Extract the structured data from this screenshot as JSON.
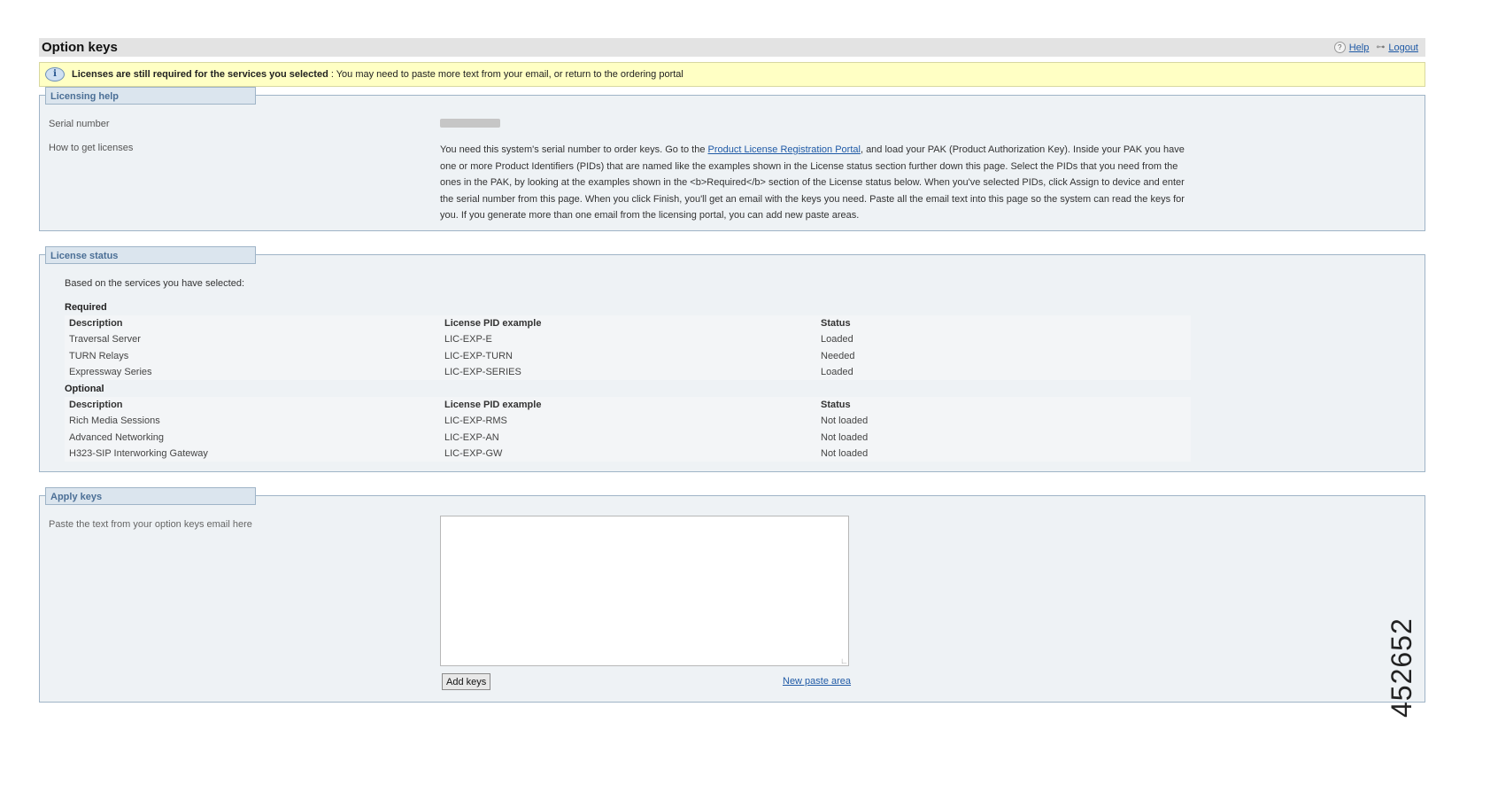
{
  "header": {
    "title": "Option keys",
    "help_label": "Help",
    "logout_label": "Logout"
  },
  "alert": {
    "bold": "Licenses are still required for the services you selected",
    "text": ": You may need to paste more text from your email, or return to the ordering portal"
  },
  "licensing_help": {
    "legend": "Licensing help",
    "serial_label": "Serial number",
    "how_label": "How to get licenses",
    "help_part1": "You need this system's serial number to order keys. Go to the ",
    "portal_link": "Product License Registration Portal",
    "help_part2": ", and load your PAK (Product Authorization Key). Inside your PAK you have one or more Product Identifiers (PIDs) that are named like the examples shown in the License status section further down this page. Select the PIDs that you need from the ones in the PAK, by looking at the examples shown in the <b>Required</b> section of the License status below. When you've selected PIDs, click Assign to device and enter the serial number from this page. When you click Finish, you'll get an email with the keys you need. Paste all the email text into this page so the system can read the keys for you. If you generate more than one email from the licensing portal, you can add new paste areas."
  },
  "license_status": {
    "legend": "License status",
    "based_on": "Based on the services you have selected:",
    "required": {
      "label": "Required",
      "headers": [
        "Description",
        "License PID example",
        "Status"
      ],
      "rows": [
        {
          "description": "Traversal Server",
          "pid": "LIC-EXP-E",
          "status": "Loaded"
        },
        {
          "description": "TURN Relays",
          "pid": "LIC-EXP-TURN",
          "status": "Needed"
        },
        {
          "description": "Expressway Series",
          "pid": "LIC-EXP-SERIES",
          "status": "Loaded"
        }
      ]
    },
    "optional": {
      "label": "Optional",
      "headers": [
        "Description",
        "License PID example",
        "Status"
      ],
      "rows": [
        {
          "description": "Rich Media Sessions",
          "pid": "LIC-EXP-RMS",
          "status": "Not loaded"
        },
        {
          "description": "Advanced Networking",
          "pid": "LIC-EXP-AN",
          "status": "Not loaded"
        },
        {
          "description": "H323-SIP Interworking Gateway",
          "pid": "LIC-EXP-GW",
          "status": "Not loaded"
        }
      ]
    }
  },
  "apply_keys": {
    "legend": "Apply keys",
    "paste_label": "Paste the text from your option keys email here",
    "textarea_value": "",
    "add_button": "Add keys",
    "new_paste_link": "New paste area"
  },
  "figure_number": "452652",
  "colors": {
    "needed": "#b01c1c",
    "link": "#1f5aa6",
    "alert_bg": "#ffffc4"
  }
}
